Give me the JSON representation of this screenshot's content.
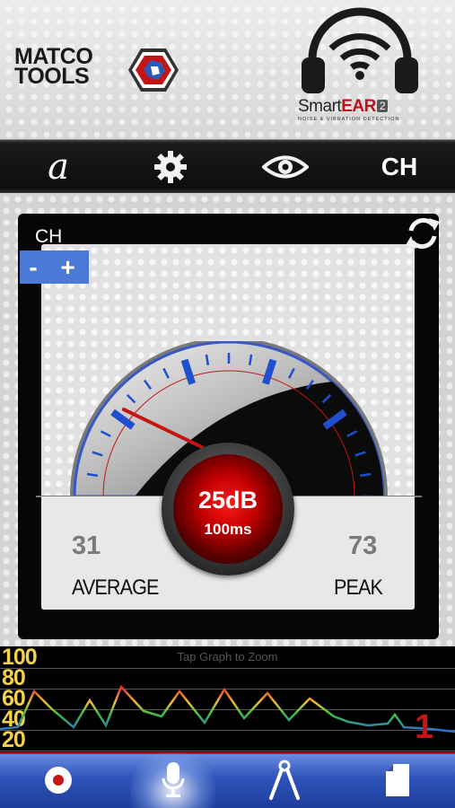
{
  "header": {
    "brand_line1": "MATCO",
    "brand_line2": "TOOLS",
    "app_name_prefix": "Smart",
    "app_name_highlight": "EAR",
    "app_version": "2",
    "app_tagline": "NOISE & VIBRATION DETECTION"
  },
  "toolbar": {
    "font_label": "a",
    "settings_icon": "gear-icon",
    "view_icon": "eye-icon",
    "channel_label": "CH"
  },
  "meter": {
    "channel_label": "CH",
    "minus_label": "-",
    "plus_label": "+",
    "reading_db": "25dB",
    "reading_interval": "100ms",
    "average_value": "31",
    "average_label": "AVERAGE",
    "peak_value": "73",
    "peak_label": "PEAK",
    "needle_level": 0.22,
    "accent_color": "#c41414",
    "tick_color": "#1f4fcf"
  },
  "graph": {
    "hint": "Tap Graph to Zoom",
    "y_labels": [
      "100",
      "80",
      "60",
      "40",
      "20"
    ],
    "channel_marker": "1"
  },
  "bottom_bar": {
    "items": [
      "record-icon",
      "microphone-icon",
      "clamp-icon",
      "document-icon"
    ],
    "active": "microphone-icon"
  }
}
